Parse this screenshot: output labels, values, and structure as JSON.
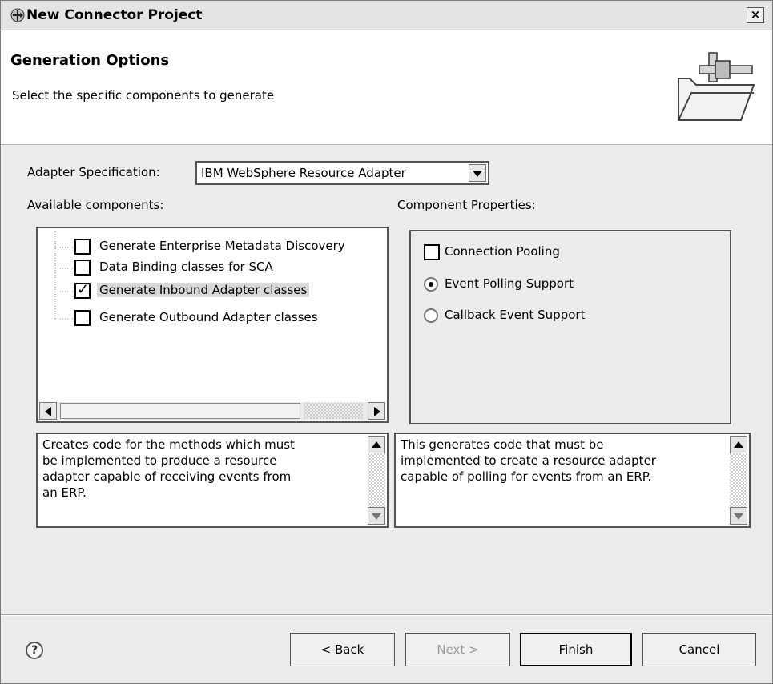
{
  "window": {
    "title": "New Connector Project",
    "close_label": "×"
  },
  "header": {
    "title": "Generation Options",
    "subtitle": "Select the specific components to generate"
  },
  "adapter_spec": {
    "label": "Adapter Specification:",
    "selected": "IBM WebSphere Resource Adapter"
  },
  "available_components": {
    "label": "Available components:",
    "items": [
      {
        "label": "Generate Enterprise Metadata Discovery",
        "checked": false
      },
      {
        "label": "Data Binding classes for SCA",
        "checked": false
      },
      {
        "label": "Generate Inbound Adapter classes",
        "checked": true,
        "selected": true
      },
      {
        "label": "Generate Outbound Adapter classes",
        "checked": false
      }
    ],
    "description": "Creates code for the methods which must\nbe implemented to produce a resource\nadapter capable of receiving events from\nan ERP."
  },
  "component_properties": {
    "label": "Component Properties:",
    "connection_pooling": {
      "label": "Connection Pooling",
      "checked": false
    },
    "event_polling": {
      "label": "Event Polling Support",
      "selected": true
    },
    "callback_event": {
      "label": "Callback Event Support",
      "selected": false
    },
    "description": "This generates code that must be\nimplemented to create a resource adapter\ncapable of polling for events from an ERP."
  },
  "buttons": {
    "help": "?",
    "back": "< Back",
    "next": "Next >",
    "finish": "Finish",
    "cancel": "Cancel"
  }
}
